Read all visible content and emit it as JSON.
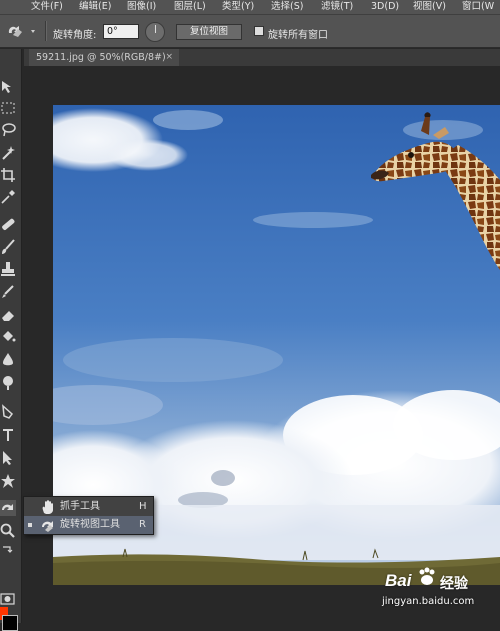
{
  "menubar": {
    "items": [
      "文件(F)",
      "编辑(E)",
      "图像(I)",
      "图层(L)",
      "类型(Y)",
      "选择(S)",
      "滤镜(T)",
      "3D(D)",
      "视图(V)",
      "窗口(W"
    ]
  },
  "options": {
    "rotation_label": "旋转角度:",
    "rotation_value": "0°",
    "reset_view_label": "复位视图",
    "rotate_all_windows_label": "旋转所有窗口",
    "rotate_all_windows_checked": false
  },
  "document_tab": {
    "title": "59211.jpg @ 50%(RGB/8#)",
    "close": "×"
  },
  "toolbar": {
    "foreground_color": "#ff3600",
    "background_color": "#000000",
    "tools": [
      "move-tool",
      "marquee-tool",
      "lasso-tool",
      "quick-select-tool",
      "crop-tool",
      "eyedropper-tool",
      "healing-brush-tool",
      "brush-tool",
      "clone-stamp-tool",
      "history-brush-tool",
      "eraser-tool",
      "paint-bucket-tool",
      "blur-tool",
      "dodge-tool",
      "pen-tool",
      "type-tool",
      "path-select-tool",
      "shape-tool",
      "rotate-view-tool",
      "zoom-tool",
      "swap-colors-icon",
      "quick-mask-icon"
    ]
  },
  "flyout": {
    "items": [
      {
        "label": "抓手工具",
        "shortcut": "H",
        "icon": "hand-icon",
        "active": false
      },
      {
        "label": "旋转视图工具",
        "shortcut": "R",
        "icon": "rotate-view-icon",
        "active": true
      }
    ]
  },
  "watermark": {
    "brand_prefix": "Bai",
    "brand_suffix": "经验",
    "url": "jingyan.baidu.com"
  }
}
